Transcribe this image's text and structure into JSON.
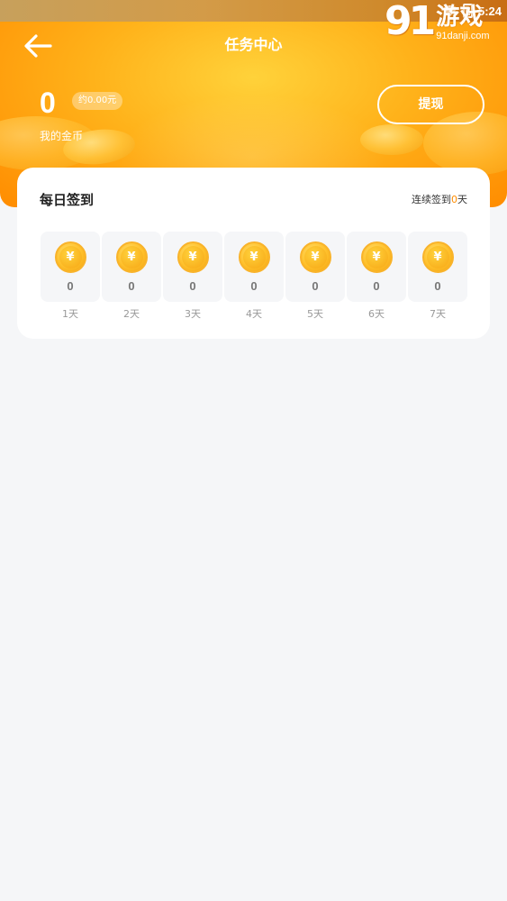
{
  "status_bar": {
    "time": "5:24"
  },
  "watermark": {
    "logo_number": "91",
    "logo_text": "游戏",
    "domain": "91danji.com"
  },
  "header": {
    "title": "任务中心",
    "coin_amount": "0",
    "yuan_value": "约0.00元",
    "coin_label": "我的金币",
    "withdraw_label": "提现"
  },
  "checkin": {
    "title": "每日签到",
    "streak_prefix": "连续签到",
    "streak_days": "0",
    "streak_suffix": "天",
    "days": [
      {
        "amount": "0",
        "label": "1天"
      },
      {
        "amount": "0",
        "label": "2天"
      },
      {
        "amount": "0",
        "label": "3天"
      },
      {
        "amount": "0",
        "label": "4天"
      },
      {
        "amount": "0",
        "label": "5天"
      },
      {
        "amount": "0",
        "label": "6天"
      },
      {
        "amount": "0",
        "label": "7天"
      }
    ]
  },
  "icons": {
    "coin_symbol": "¥",
    "back": "arrow-left-icon"
  },
  "colors": {
    "accent": "#ff8c00",
    "coin": "#ffc02a",
    "background": "#f5f6f8"
  }
}
